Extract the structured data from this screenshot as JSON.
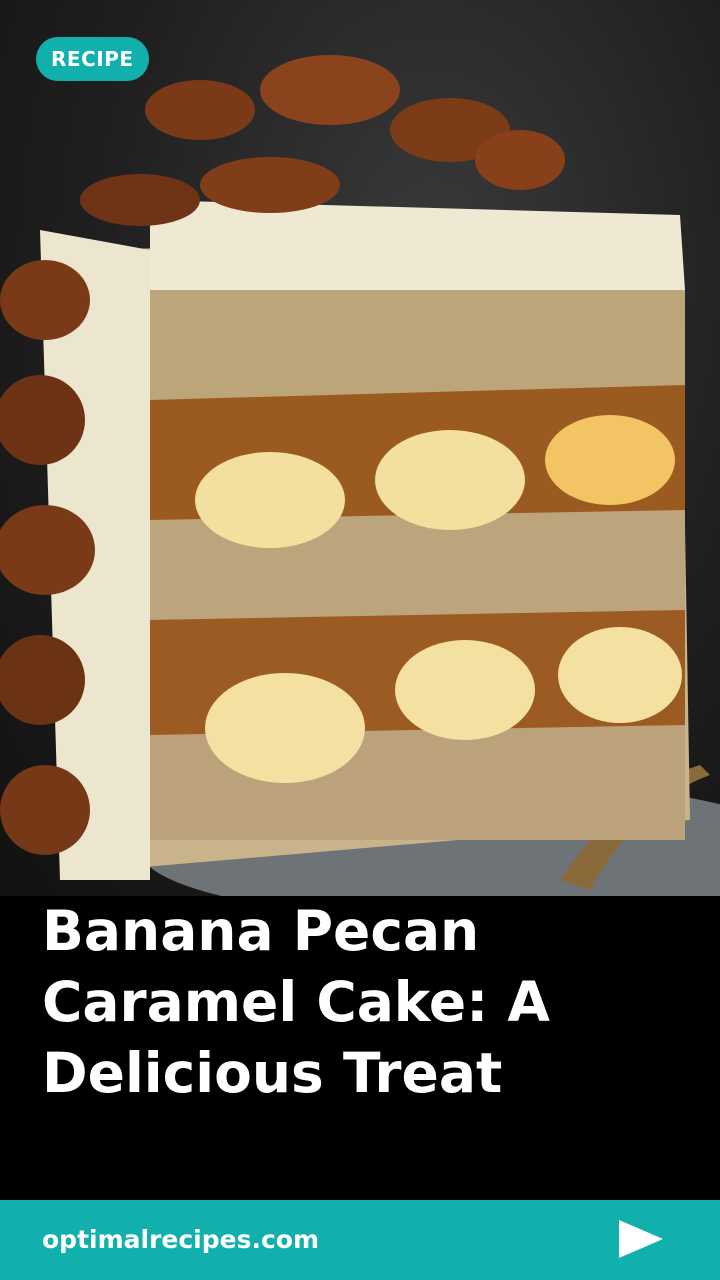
{
  "badge": {
    "label": "RECIPE"
  },
  "title": {
    "text": "Banana Pecan Caramel Cake: A Delicious Treat"
  },
  "footer": {
    "site": "optimalrecipes.com",
    "next_icon": "play-arrow-icon"
  },
  "colors": {
    "accent": "#12b0ad",
    "title_bg": "#000000",
    "text": "#ffffff"
  }
}
